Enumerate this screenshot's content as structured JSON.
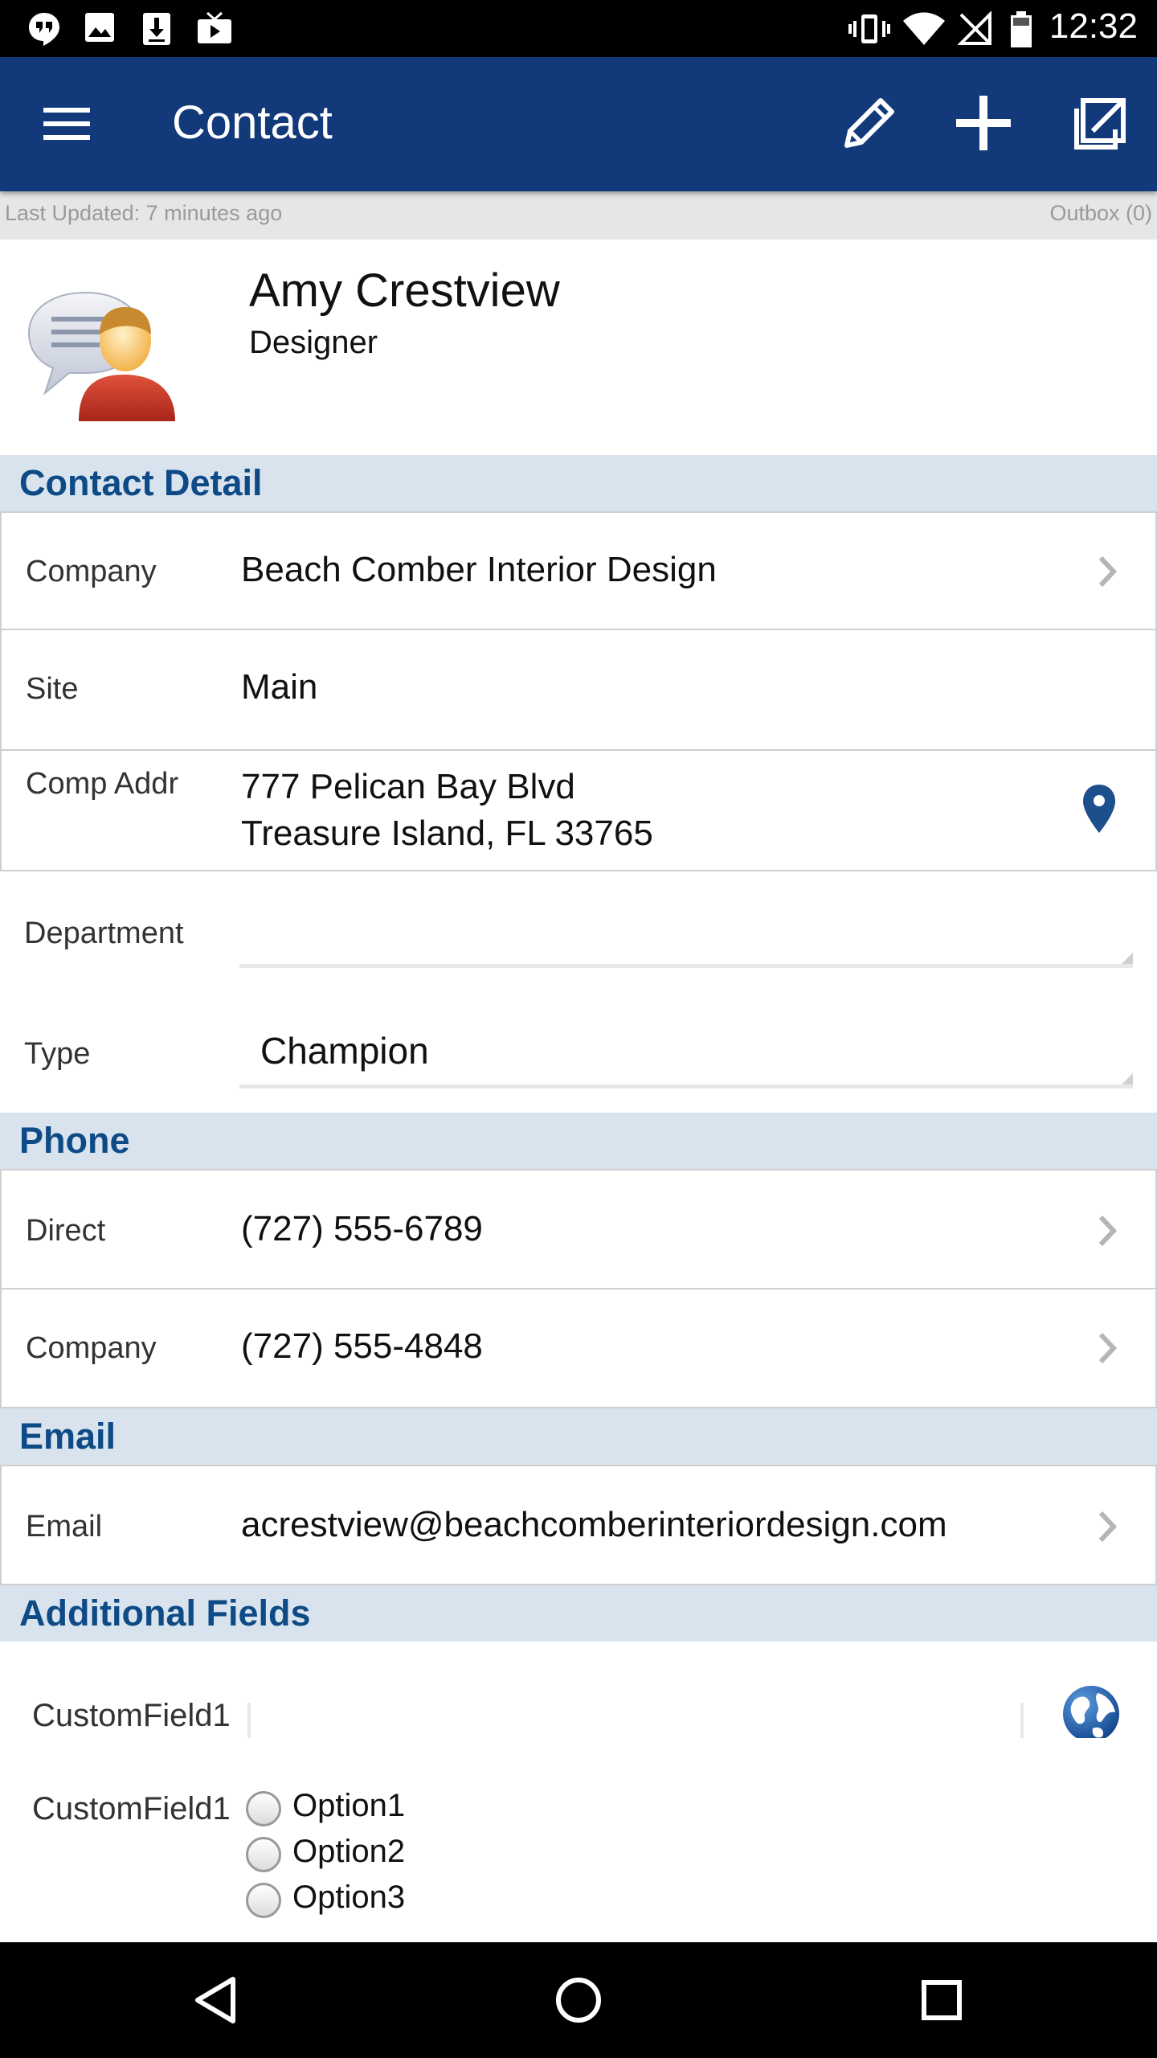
{
  "status_bar": {
    "time": "12:32"
  },
  "app_bar": {
    "title": "Contact"
  },
  "sync_bar": {
    "last_updated": "Last Updated: 7 minutes ago",
    "outbox": "Outbox (0)"
  },
  "profile": {
    "name": "Amy Crestview",
    "role": "Designer"
  },
  "contact_detail": {
    "header": "Contact Detail",
    "company_label": "Company",
    "company_value": "Beach Comber Interior Design",
    "site_label": "Site",
    "site_value": "Main",
    "comp_addr_label": "Comp Addr",
    "comp_addr_line1": "777 Pelican Bay Blvd",
    "comp_addr_line2": "Treasure Island, FL 33765",
    "department_label": "Department",
    "department_value": "",
    "type_label": "Type",
    "type_value": "Champion"
  },
  "phone": {
    "header": "Phone",
    "direct_label": "Direct",
    "direct_value": "(727) 555-6789",
    "company_label": "Company",
    "company_value": "(727) 555-4848"
  },
  "email": {
    "header": "Email",
    "email_label": "Email",
    "email_value": "acrestview@beachcomberinteriordesign.com"
  },
  "additional": {
    "header": "Additional Fields",
    "custom_text_label": "CustomField1",
    "custom_text_value": "",
    "custom_radio_label": "CustomField1",
    "options": [
      "Option1",
      "Option2",
      "Option3"
    ]
  },
  "colors": {
    "app_bar": "#12397a",
    "section_header_bg": "#d8e3ed",
    "section_header_text": "#0d4a86",
    "accent_pin": "#1c4f8c"
  }
}
